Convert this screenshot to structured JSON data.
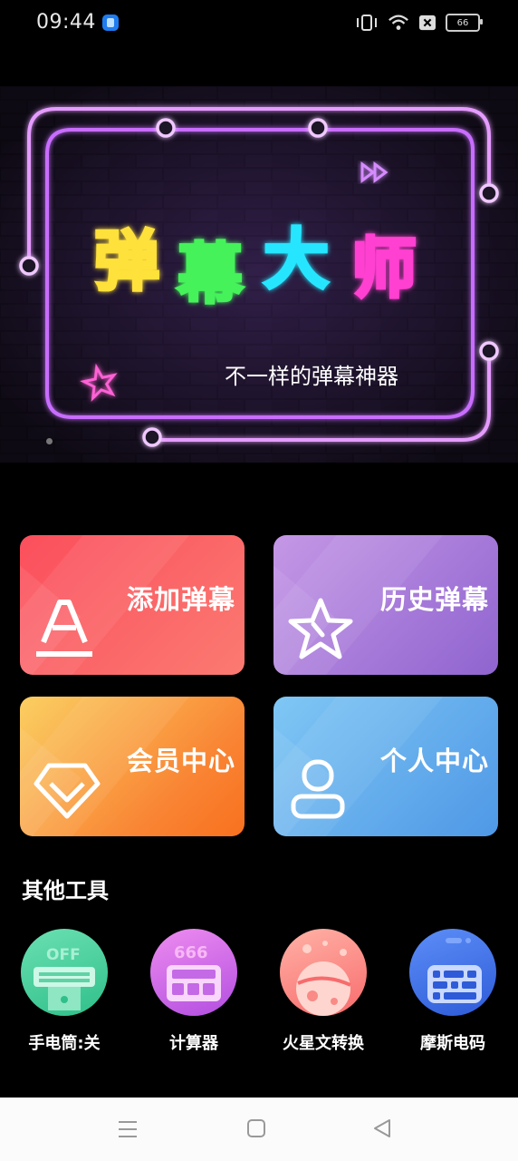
{
  "status_bar": {
    "time": "09:44",
    "battery_level": "66"
  },
  "banner": {
    "title_chars": [
      "弹",
      "幕",
      "大",
      "师"
    ],
    "title_colors": [
      "#ffe13a",
      "#45f25a",
      "#25e6ff",
      "#ff3fd0"
    ],
    "subtitle": "不一样的弹幕神器"
  },
  "cards": [
    {
      "label": "添加弹幕",
      "icon": "letter-a-icon"
    },
    {
      "label": "历史弹幕",
      "icon": "star-icon"
    },
    {
      "label": "会员中心",
      "icon": "diamond-icon"
    },
    {
      "label": "个人中心",
      "icon": "person-icon"
    }
  ],
  "other_tools": {
    "title": "其他工具",
    "items": [
      {
        "label": "手电筒:关",
        "icon": "flashlight-icon",
        "badge": "OFF"
      },
      {
        "label": "计算器",
        "icon": "calculator-icon",
        "badge": "666"
      },
      {
        "label": "火星文转换",
        "icon": "planet-icon"
      },
      {
        "label": "摩斯电码",
        "icon": "morse-keyboard-icon"
      }
    ]
  },
  "nav": {
    "menu": "menu-icon",
    "home": "home-icon",
    "back": "back-icon"
  }
}
